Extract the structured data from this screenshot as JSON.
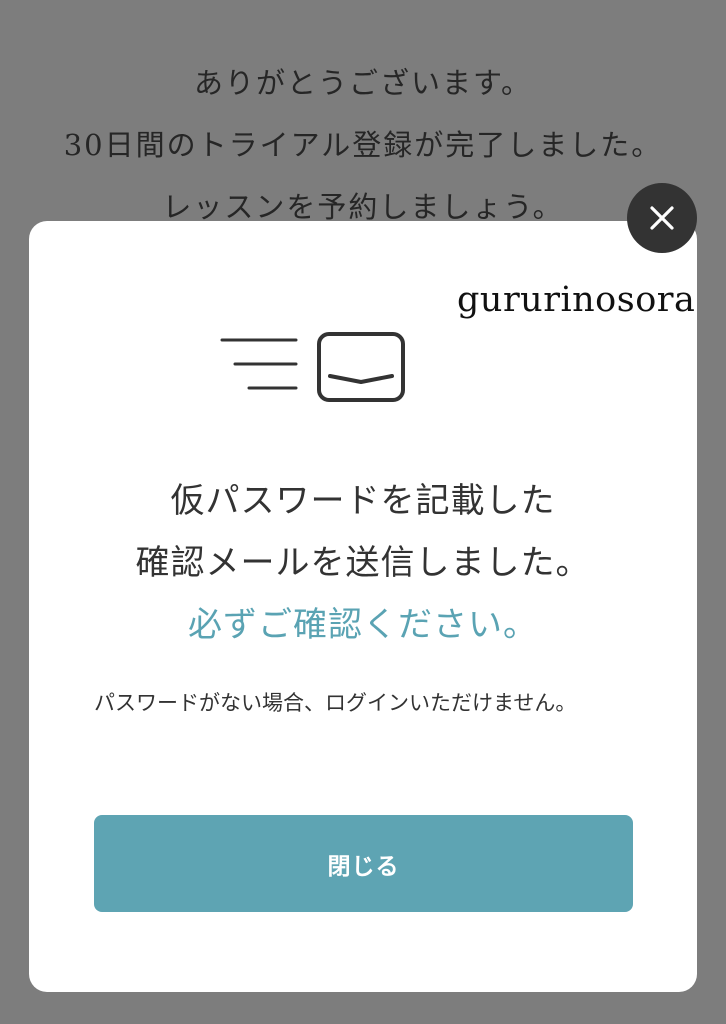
{
  "background": {
    "lines": [
      "ありがとうございます。",
      "30日間のトライアル登録が完了しました。",
      "レッスンを予約しましょう。"
    ]
  },
  "watermark": "gururinosora",
  "modal": {
    "icon": "mail-sent-icon",
    "title_line1": "仮パスワードを記載した",
    "title_line2": "確認メールを送信しました。",
    "title_line3": "必ずご確認ください。",
    "note": "パスワードがない場合、ログインいただけません。",
    "close_button_label": "閉じる",
    "close_icon": "×"
  },
  "colors": {
    "overlay": "#7d7d7d",
    "accent": "#5ea4b3",
    "close_circle": "#333333"
  }
}
